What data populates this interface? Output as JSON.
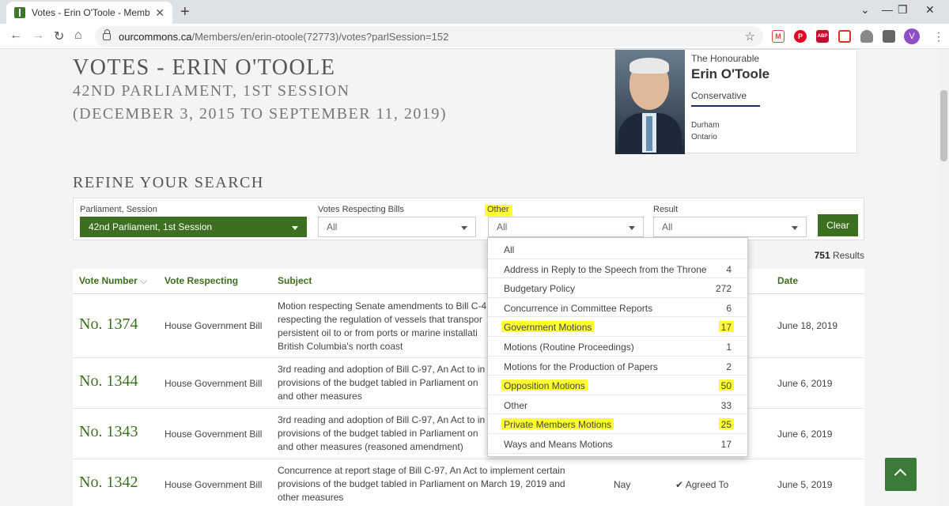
{
  "browser": {
    "tab_title": "Votes - Erin O'Toole - Members o",
    "url_host": "ourcommons.ca",
    "url_path": "/Members/en/erin-otoole(72773)/votes?parlSession=152",
    "profile_initial": "V",
    "extensions": [
      {
        "name": "gmail-icon",
        "label": "M",
        "color": "#ea4335"
      },
      {
        "name": "pinterest-icon",
        "label": "P",
        "color": "#e60023"
      },
      {
        "name": "adblock-icon",
        "label": "ABP",
        "color": "#c70d2c"
      },
      {
        "name": "extension-red-icon",
        "label": "",
        "color": "#d93025"
      },
      {
        "name": "drive-icon",
        "label": "",
        "color": "#777777"
      },
      {
        "name": "ext-grey-icon",
        "label": "",
        "color": "#555555"
      },
      {
        "name": "puzzle-icon",
        "label": "",
        "color": "#555555"
      }
    ]
  },
  "page": {
    "title": "VOTES - ERIN O'TOOLE",
    "session": "42ND PARLIAMENT, 1ST SESSION",
    "dates": "(DECEMBER 3, 2015 TO SEPTEMBER 11, 2019)"
  },
  "member": {
    "honour": "The Honourable",
    "name": "Erin O'Toole",
    "party": "Conservative",
    "riding": "Durham",
    "province": "Ontario"
  },
  "refine": {
    "heading": "REFINE YOUR SEARCH",
    "parliament_label": "Parliament, Session",
    "parliament_value": "42nd Parliament, 1st Session",
    "bills_label": "Votes Respecting Bills",
    "bills_value": "All",
    "other_label": "Other",
    "other_value": "All",
    "result_label": "Result",
    "result_value": "All",
    "clear_label": "Clear",
    "results_count": "751",
    "results_suffix": " Results"
  },
  "dropdown": {
    "options": [
      {
        "label": "All",
        "count": "",
        "highlight": false
      },
      {
        "label": "Address in Reply to the Speech from the Throne",
        "count": "4",
        "highlight": false
      },
      {
        "label": "Budgetary Policy",
        "count": "272",
        "highlight": false
      },
      {
        "label": "Concurrence in Committee Reports",
        "count": "6",
        "highlight": false
      },
      {
        "label": "Government Motions",
        "count": "17",
        "highlight": true
      },
      {
        "label": "Motions (Routine Proceedings)",
        "count": "1",
        "highlight": false
      },
      {
        "label": "Motions for the Production of Papers",
        "count": "2",
        "highlight": false
      },
      {
        "label": "Opposition Motions",
        "count": "50",
        "highlight": true
      },
      {
        "label": "Other",
        "count": "33",
        "highlight": false
      },
      {
        "label": "Private Members Motions",
        "count": "25",
        "highlight": true
      },
      {
        "label": "Ways and Means Motions",
        "count": "17",
        "highlight": false
      }
    ]
  },
  "table": {
    "headers": {
      "vote_number": "Vote Number",
      "vote_respecting": "Vote Respecting",
      "subject": "Subject",
      "date": "Date"
    },
    "rows": [
      {
        "number": "No. 1374",
        "respecting": "House Government Bill",
        "subject": "Motion respecting Senate amendments to Bill C-4 respecting the regulation of vessels that transpor persistent oil to or from ports or marine installati British Columbia's north coast",
        "vote": "",
        "result": "",
        "date": "June 18, 2019"
      },
      {
        "number": "No. 1344",
        "respecting": "House Government Bill",
        "subject": "3rd reading and adoption of Bill C-97, An Act to in provisions of the budget tabled in Parliament on and other measures",
        "vote": "",
        "result": "",
        "date": "June 6, 2019"
      },
      {
        "number": "No. 1343",
        "respecting": "House Government Bill",
        "subject": "3rd reading and adoption of Bill C-97, An Act to in provisions of the budget tabled in Parliament on and other measures (reasoned amendment)",
        "vote": "",
        "result": "",
        "date": "June 6, 2019"
      },
      {
        "number": "No. 1342",
        "respecting": "House Government Bill",
        "subject": "Concurrence at report stage of Bill C-97, An Act to implement certain provisions of the budget tabled in Parliament on March 19, 2019 and other measures",
        "vote": "Nay",
        "result": "✔ Agreed To",
        "date": "June 5, 2019"
      }
    ]
  },
  "colors": {
    "accent_green": "#3c6f1f",
    "highlight": "#ffff33",
    "party_underline": "#1a2a6c"
  }
}
